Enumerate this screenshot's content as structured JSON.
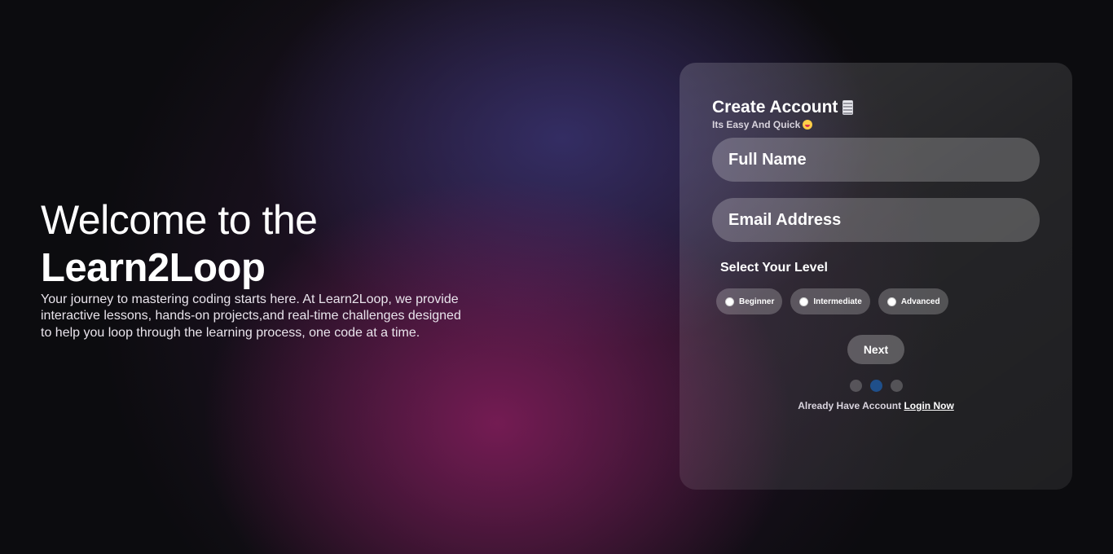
{
  "hero": {
    "line1": "Welcome to the",
    "line2": "Learn2Loop",
    "description": "Your journey to mastering coding starts here. At Learn2Loop, we provide interactive lessons, hands-on projects,and real-time challenges designed to help you loop through the learning process, one code at a time."
  },
  "form": {
    "title": "Create Account",
    "title_icon": "notepad-icon",
    "subtitle": "Its Easy And Quick",
    "subtitle_icon": "starstruck-emoji-icon",
    "full_name": {
      "placeholder": "Full Name",
      "value": ""
    },
    "email": {
      "placeholder": "Email Address",
      "value": ""
    },
    "level_label": "Select Your Level",
    "levels": [
      "Beginner",
      "Intermediate",
      "Advanced"
    ],
    "next_label": "Next",
    "steps": {
      "total": 3,
      "current": 2
    },
    "login_prompt": "Already Have Account",
    "login_link": "Login Now"
  },
  "colors": {
    "background": "#0c0c0f",
    "glow_magenta": "#781c55",
    "glow_indigo": "#37326e",
    "active_dot": "#1f4f8a"
  }
}
